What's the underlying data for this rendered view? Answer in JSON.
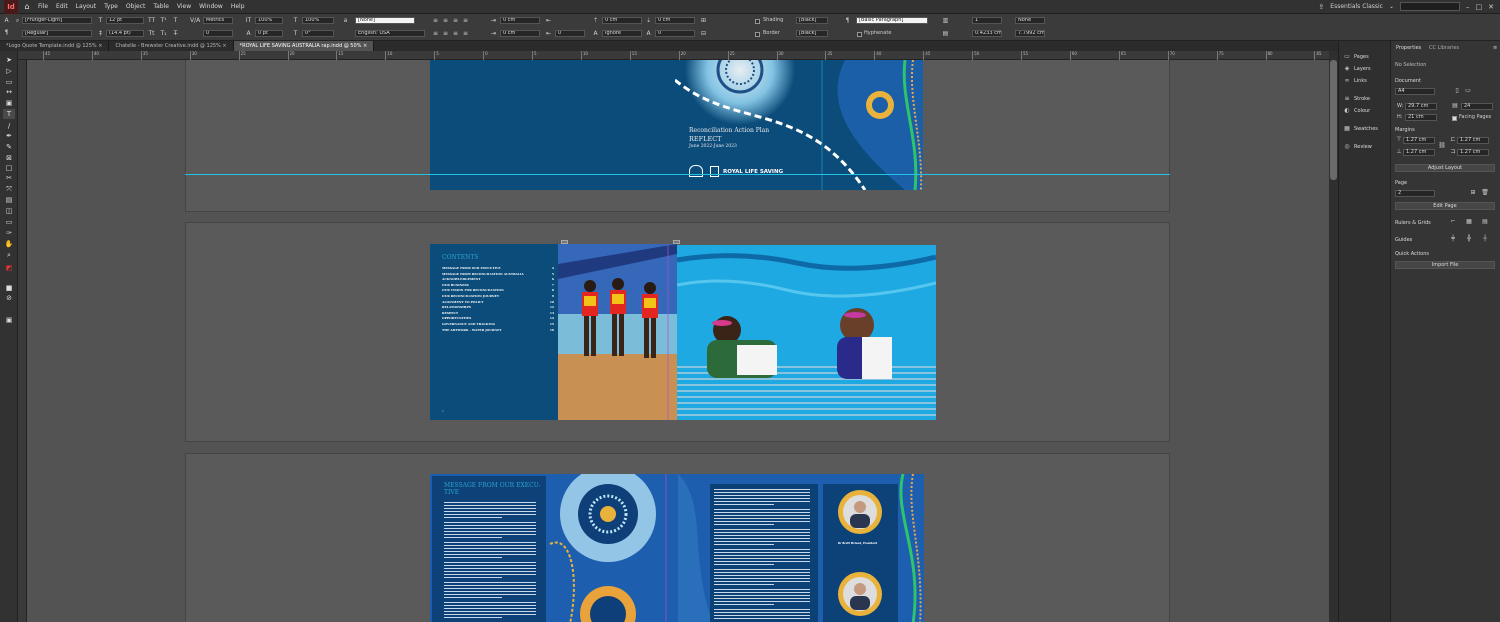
{
  "menu": [
    "File",
    "Edit",
    "Layout",
    "Type",
    "Object",
    "Table",
    "View",
    "Window",
    "Help"
  ],
  "workspace": "Essentials Classic",
  "control": {
    "font_family": "[Frutiger-Light]",
    "font_style": "[Regular]",
    "font_size": "12 pt",
    "leading": "(14.4 pt)",
    "kerning": "Metrics",
    "tracking": "0",
    "vscale": "100%",
    "hscale": "100%",
    "baseline": "0 pt",
    "skew": "0°",
    "char_style": "[None]",
    "language": "English: USA",
    "indent1": "0 cm",
    "indent2": "0 cm",
    "indent3": "0 cm",
    "indent4": "0 cm",
    "indent5": "0 cm",
    "indent6": "0 cm",
    "drop1": "0",
    "drop2": "0",
    "ignore": "Ignore",
    "shading_label": "Shading",
    "border_label": "Border",
    "swatch1": "[Black]",
    "swatch2": "[Black]",
    "para_style": "[Basic Paragraph]",
    "hyphenate_label": "Hyphenate",
    "cols": "1",
    "gutter": "0.4233 cm",
    "none": "None",
    "width_val": "7.7992 cm"
  },
  "tabs": [
    "*Logo Quote Template.indd @ 125%",
    "Chatelle - Brewster Creative.indd @ 125%",
    "*ROYAL LIFE SAVING AUSTRALIA rap.indd @ 50%"
  ],
  "ruler_numbers": [
    "45",
    "40",
    "35",
    "30",
    "25",
    "20",
    "15",
    "10",
    "5",
    "0",
    "5",
    "10",
    "15",
    "20",
    "25",
    "30",
    "35",
    "40",
    "45",
    "50",
    "55",
    "60",
    "65",
    "70",
    "75",
    "80",
    "85",
    "90",
    "95"
  ],
  "dock": [
    "Pages",
    "Layers",
    "Links",
    "Stroke",
    "Colour",
    "Swatches",
    "Review"
  ],
  "props": {
    "tab1": "Properties",
    "tab2": "CC Libraries",
    "no_selection": "No Selection",
    "document": "Document",
    "size": "A4",
    "w": "29.7 cm",
    "h": "21 cm",
    "pages_count": "24",
    "facing": "Facing Pages",
    "margins": "Margins",
    "m1": "1.27 cm",
    "m2": "1.27 cm",
    "m3": "1.27 cm",
    "m4": "1.27 cm",
    "adjust": "Adjust Layout",
    "page": "Page",
    "page_val": "2",
    "edit_page": "Edit Page",
    "rulers": "Rulers & Grids",
    "guides": "Guides",
    "quick": "Quick Actions",
    "import": "Import File"
  },
  "cover": {
    "title": "Reconciliation Action Plan",
    "subtitle": "REFLECT",
    "date": "June 2022-June 2023",
    "brand": "ROYAL LIFE SAVING"
  },
  "contents": {
    "heading": "CONTENTS",
    "items": [
      {
        "t": "MESSAGE FROM OUR EXECUTIVE",
        "p": "4"
      },
      {
        "t": "MESSAGE FROM RECONCILIATION AUSTRALIA",
        "p": "5"
      },
      {
        "t": "ACKNOWLEDGEMENT",
        "p": "6"
      },
      {
        "t": "OUR BUSINESS",
        "p": "7"
      },
      {
        "t": "OUR VISION FOR RECONCILIATION",
        "p": "8"
      },
      {
        "t": "OUR RECONCILIATION JOURNEY",
        "p": "9"
      },
      {
        "t": "ALIGNMENT TO POLICY",
        "p": "10"
      },
      {
        "t": "RELATIONSHIPS",
        "p": "12"
      },
      {
        "t": "RESPECT",
        "p": "13"
      },
      {
        "t": "OPPORTUNITIES",
        "p": "14"
      },
      {
        "t": "GOVERNANCE AND TRACKING",
        "p": "15"
      },
      {
        "t": "THE ARTWORK - WATER JOURNEY",
        "p": "16"
      }
    ]
  },
  "exec": {
    "heading1": "MESSAGE FROM OUR EXECU-",
    "heading2": "TIVE",
    "caption": "Dr Brett Mcleod, President"
  },
  "colors": {
    "navy": "#0c4c7a",
    "teal": "#2aa4d2",
    "pool": "#1aa8df"
  }
}
